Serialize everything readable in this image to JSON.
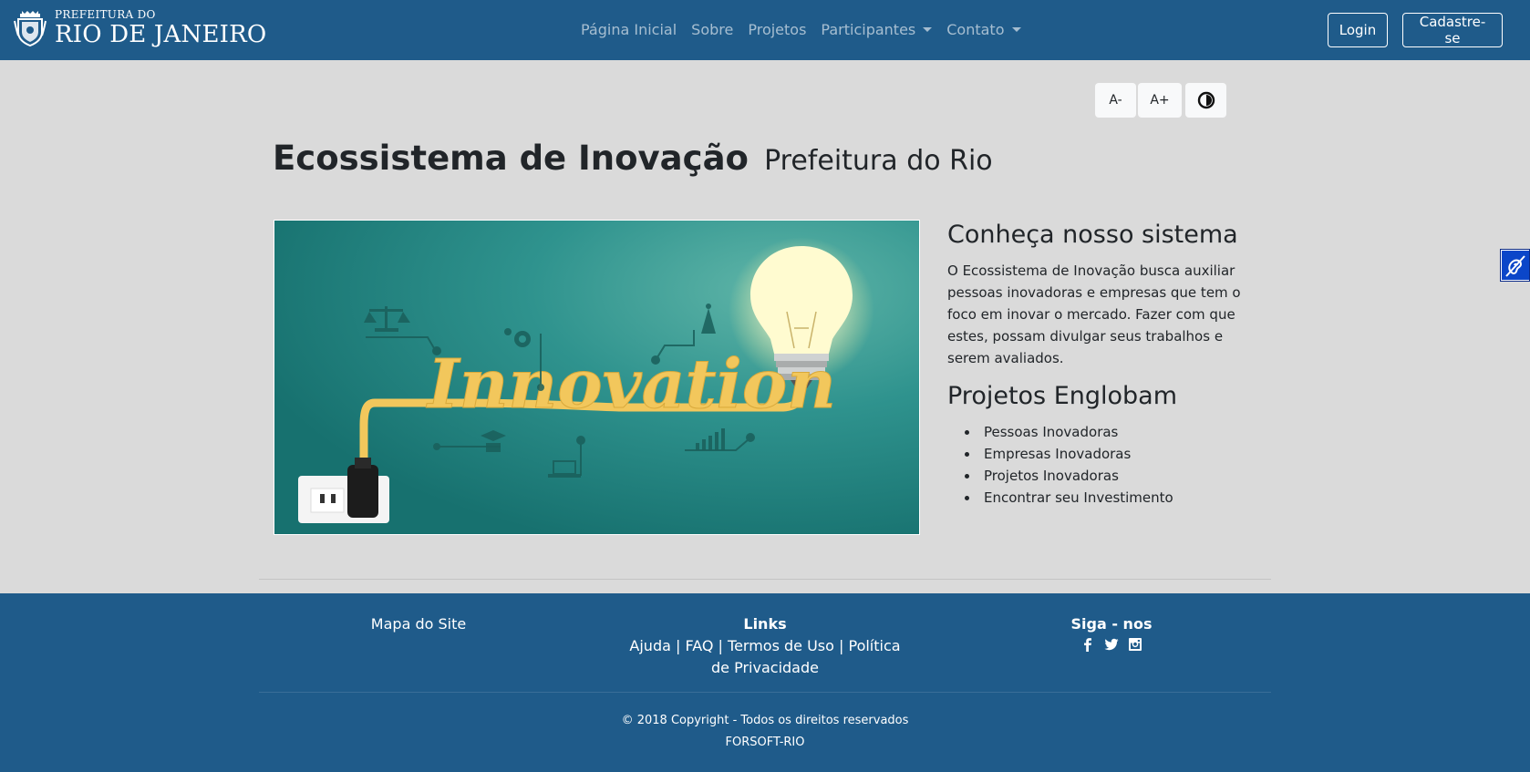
{
  "brand": {
    "small": "PREFEITURA DO",
    "big": "RIO DE JANEIRO",
    "crest_icon": "city-crest-icon"
  },
  "nav": {
    "items": [
      {
        "label": "Página Inicial"
      },
      {
        "label": "Sobre"
      },
      {
        "label": "Projetos"
      },
      {
        "label": "Participantes",
        "dropdown": true
      },
      {
        "label": "Contato",
        "dropdown": true
      }
    ],
    "login": "Login",
    "signup": "Cadastre-se"
  },
  "accessibility": {
    "decrease": "A-",
    "increase": "A+",
    "contrast_icon": "contrast-icon"
  },
  "header": {
    "title": "Ecossistema de Inovação",
    "subtitle": "Prefeitura do Rio"
  },
  "hero": {
    "word": "Innovation",
    "alt_icons": [
      "balance-scale-icon",
      "gear-icon",
      "antenna-icon",
      "graduate-icon",
      "laptop-icon",
      "bar-chart-icon",
      "light-bulb-icon",
      "power-outlet-icon"
    ]
  },
  "about": {
    "heading": "Conheça nosso sistema",
    "text": "O Ecossistema de Inovação busca auxiliar pessoas inovadoras e empresas que tem o foco em inovar o mercado. Fazer com que estes, possam divulgar seus trabalhos e serem avaliados.",
    "projects_heading": "Projetos Englobam",
    "projects": [
      "Pessoas Inovadoras",
      "Empresas Inovadoras",
      "Projetos Inovadoras",
      "Encontrar seu Investimento"
    ]
  },
  "footer": {
    "sitemap": "Mapa do Site",
    "links_heading": "Links",
    "links_text": "Ajuda | FAQ | Termos de Uso | Política de Privacidade",
    "social_heading": "Siga - nos",
    "social_icons": [
      "facebook-icon",
      "twitter-icon",
      "instagram-icon"
    ],
    "copyright": "© 2018 Copyright - Todos os direitos reservados",
    "company": "FORSOFT-RIO"
  },
  "colors": {
    "navbar": "#1f5b8a",
    "page_bg": "#dadada",
    "footer": "#1f5b8a",
    "hero_teal": "#2e9590",
    "innovation_yellow": "#f2c75c"
  }
}
